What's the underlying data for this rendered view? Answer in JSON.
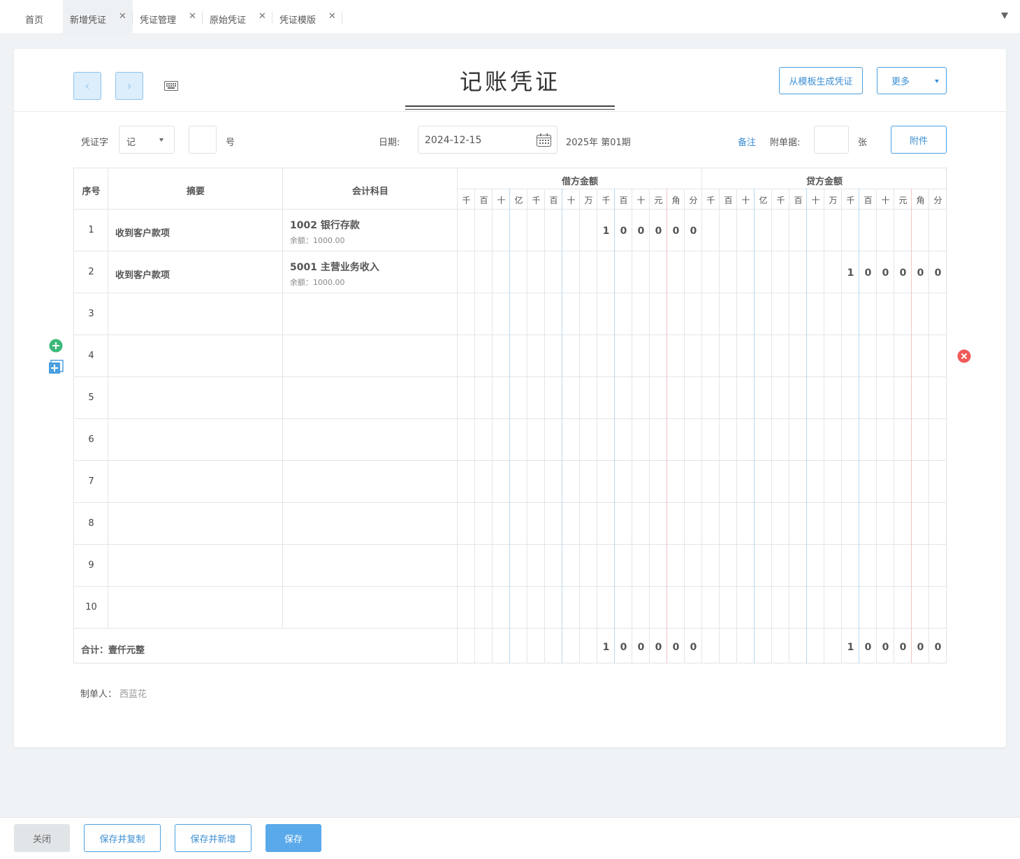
{
  "tabs": [
    {
      "label": "首页",
      "closable": false
    },
    {
      "label": "新增凭证",
      "closable": true
    },
    {
      "label": "凭证管理",
      "closable": true
    },
    {
      "label": "原始凭证",
      "closable": true
    },
    {
      "label": "凭证模版",
      "closable": true
    }
  ],
  "voucher": {
    "title": "记账凭证",
    "from_template_label": "从模板生成凭证",
    "more_label": "更多",
    "word_label": "凭证字",
    "word_value": "记",
    "number_value": "",
    "number_suffix": "号",
    "date_label": "日期:",
    "date_value": "2024-12-15",
    "period_text": "2025年 第01期",
    "remark_link": "备注",
    "attach_count_label": "附单据:",
    "attach_count_value": "",
    "attach_unit": "张",
    "attach_button": "附件"
  },
  "table": {
    "col_seq": "序号",
    "col_summary": "摘要",
    "col_account": "会计科目",
    "col_debit": "借方金额",
    "col_credit": "贷方金额",
    "units": [
      "千",
      "百",
      "十",
      "亿",
      "千",
      "百",
      "十",
      "万",
      "千",
      "百",
      "十",
      "元",
      "角",
      "分"
    ],
    "rows": [
      {
        "seq": "1",
        "summary": "收到客户款项",
        "account": "1002 银行存款",
        "balance": "余额：1000.00",
        "debit": "100000",
        "credit": ""
      },
      {
        "seq": "2",
        "summary": "收到客户款项",
        "account": "5001 主营业务收入",
        "balance": "余额：1000.00",
        "debit": "",
        "credit": "100000"
      },
      {
        "seq": "3",
        "summary": "",
        "account": "",
        "balance": "",
        "debit": "",
        "credit": ""
      },
      {
        "seq": "4",
        "summary": "",
        "account": "",
        "balance": "",
        "debit": "",
        "credit": ""
      },
      {
        "seq": "5",
        "summary": "",
        "account": "",
        "balance": "",
        "debit": "",
        "credit": ""
      },
      {
        "seq": "6",
        "summary": "",
        "account": "",
        "balance": "",
        "debit": "",
        "credit": ""
      },
      {
        "seq": "7",
        "summary": "",
        "account": "",
        "balance": "",
        "debit": "",
        "credit": ""
      },
      {
        "seq": "8",
        "summary": "",
        "account": "",
        "balance": "",
        "debit": "",
        "credit": ""
      },
      {
        "seq": "9",
        "summary": "",
        "account": "",
        "balance": "",
        "debit": "",
        "credit": ""
      },
      {
        "seq": "10",
        "summary": "",
        "account": "",
        "balance": "",
        "debit": "",
        "credit": ""
      }
    ],
    "total_label": "合计：壹仟元整",
    "total_debit": "100000",
    "total_credit": "100000"
  },
  "maker_label": "制单人：",
  "maker_name": "西蓝花",
  "footer": {
    "close": "关闭",
    "save_copy": "保存并复制",
    "save_new": "保存并新增",
    "save": "保存"
  },
  "colors": {
    "accent": "#4a9fdf",
    "primary_btn": "#5aa9ea",
    "delete": "#ef5a5a",
    "add": "#3cb97a"
  }
}
